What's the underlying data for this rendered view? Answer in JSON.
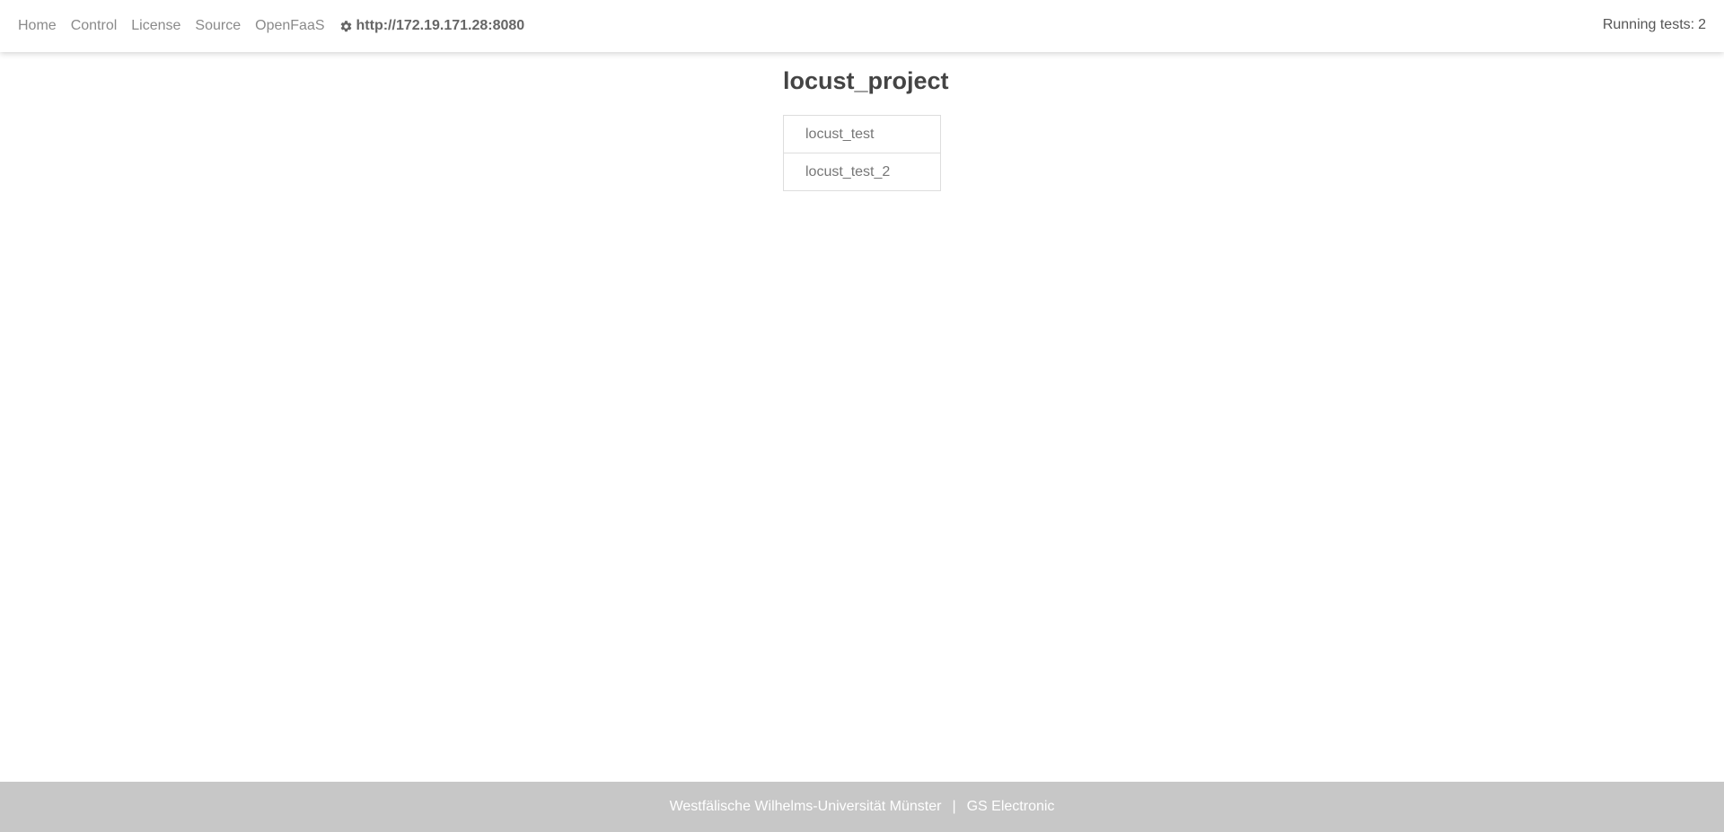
{
  "nav": {
    "items": [
      {
        "label": "Home"
      },
      {
        "label": "Control"
      },
      {
        "label": "License"
      },
      {
        "label": "Source"
      },
      {
        "label": "OpenFaaS"
      }
    ],
    "host": {
      "icon": "gear-icon",
      "label": "http://172.19.171.28:8080"
    }
  },
  "status": {
    "running_label": "Running tests:",
    "running_count": "2"
  },
  "main": {
    "title": "locust_project",
    "tests": [
      {
        "label": "locust_test"
      },
      {
        "label": "locust_test_2"
      }
    ]
  },
  "footer": {
    "university": "Westfälische Wilhelms-Universität Münster",
    "separator": "|",
    "company": "GS Electronic"
  },
  "colors": {
    "footer_bg": "#c7c7c7",
    "nav_link": "#8a8a8a",
    "text": "#444444"
  }
}
